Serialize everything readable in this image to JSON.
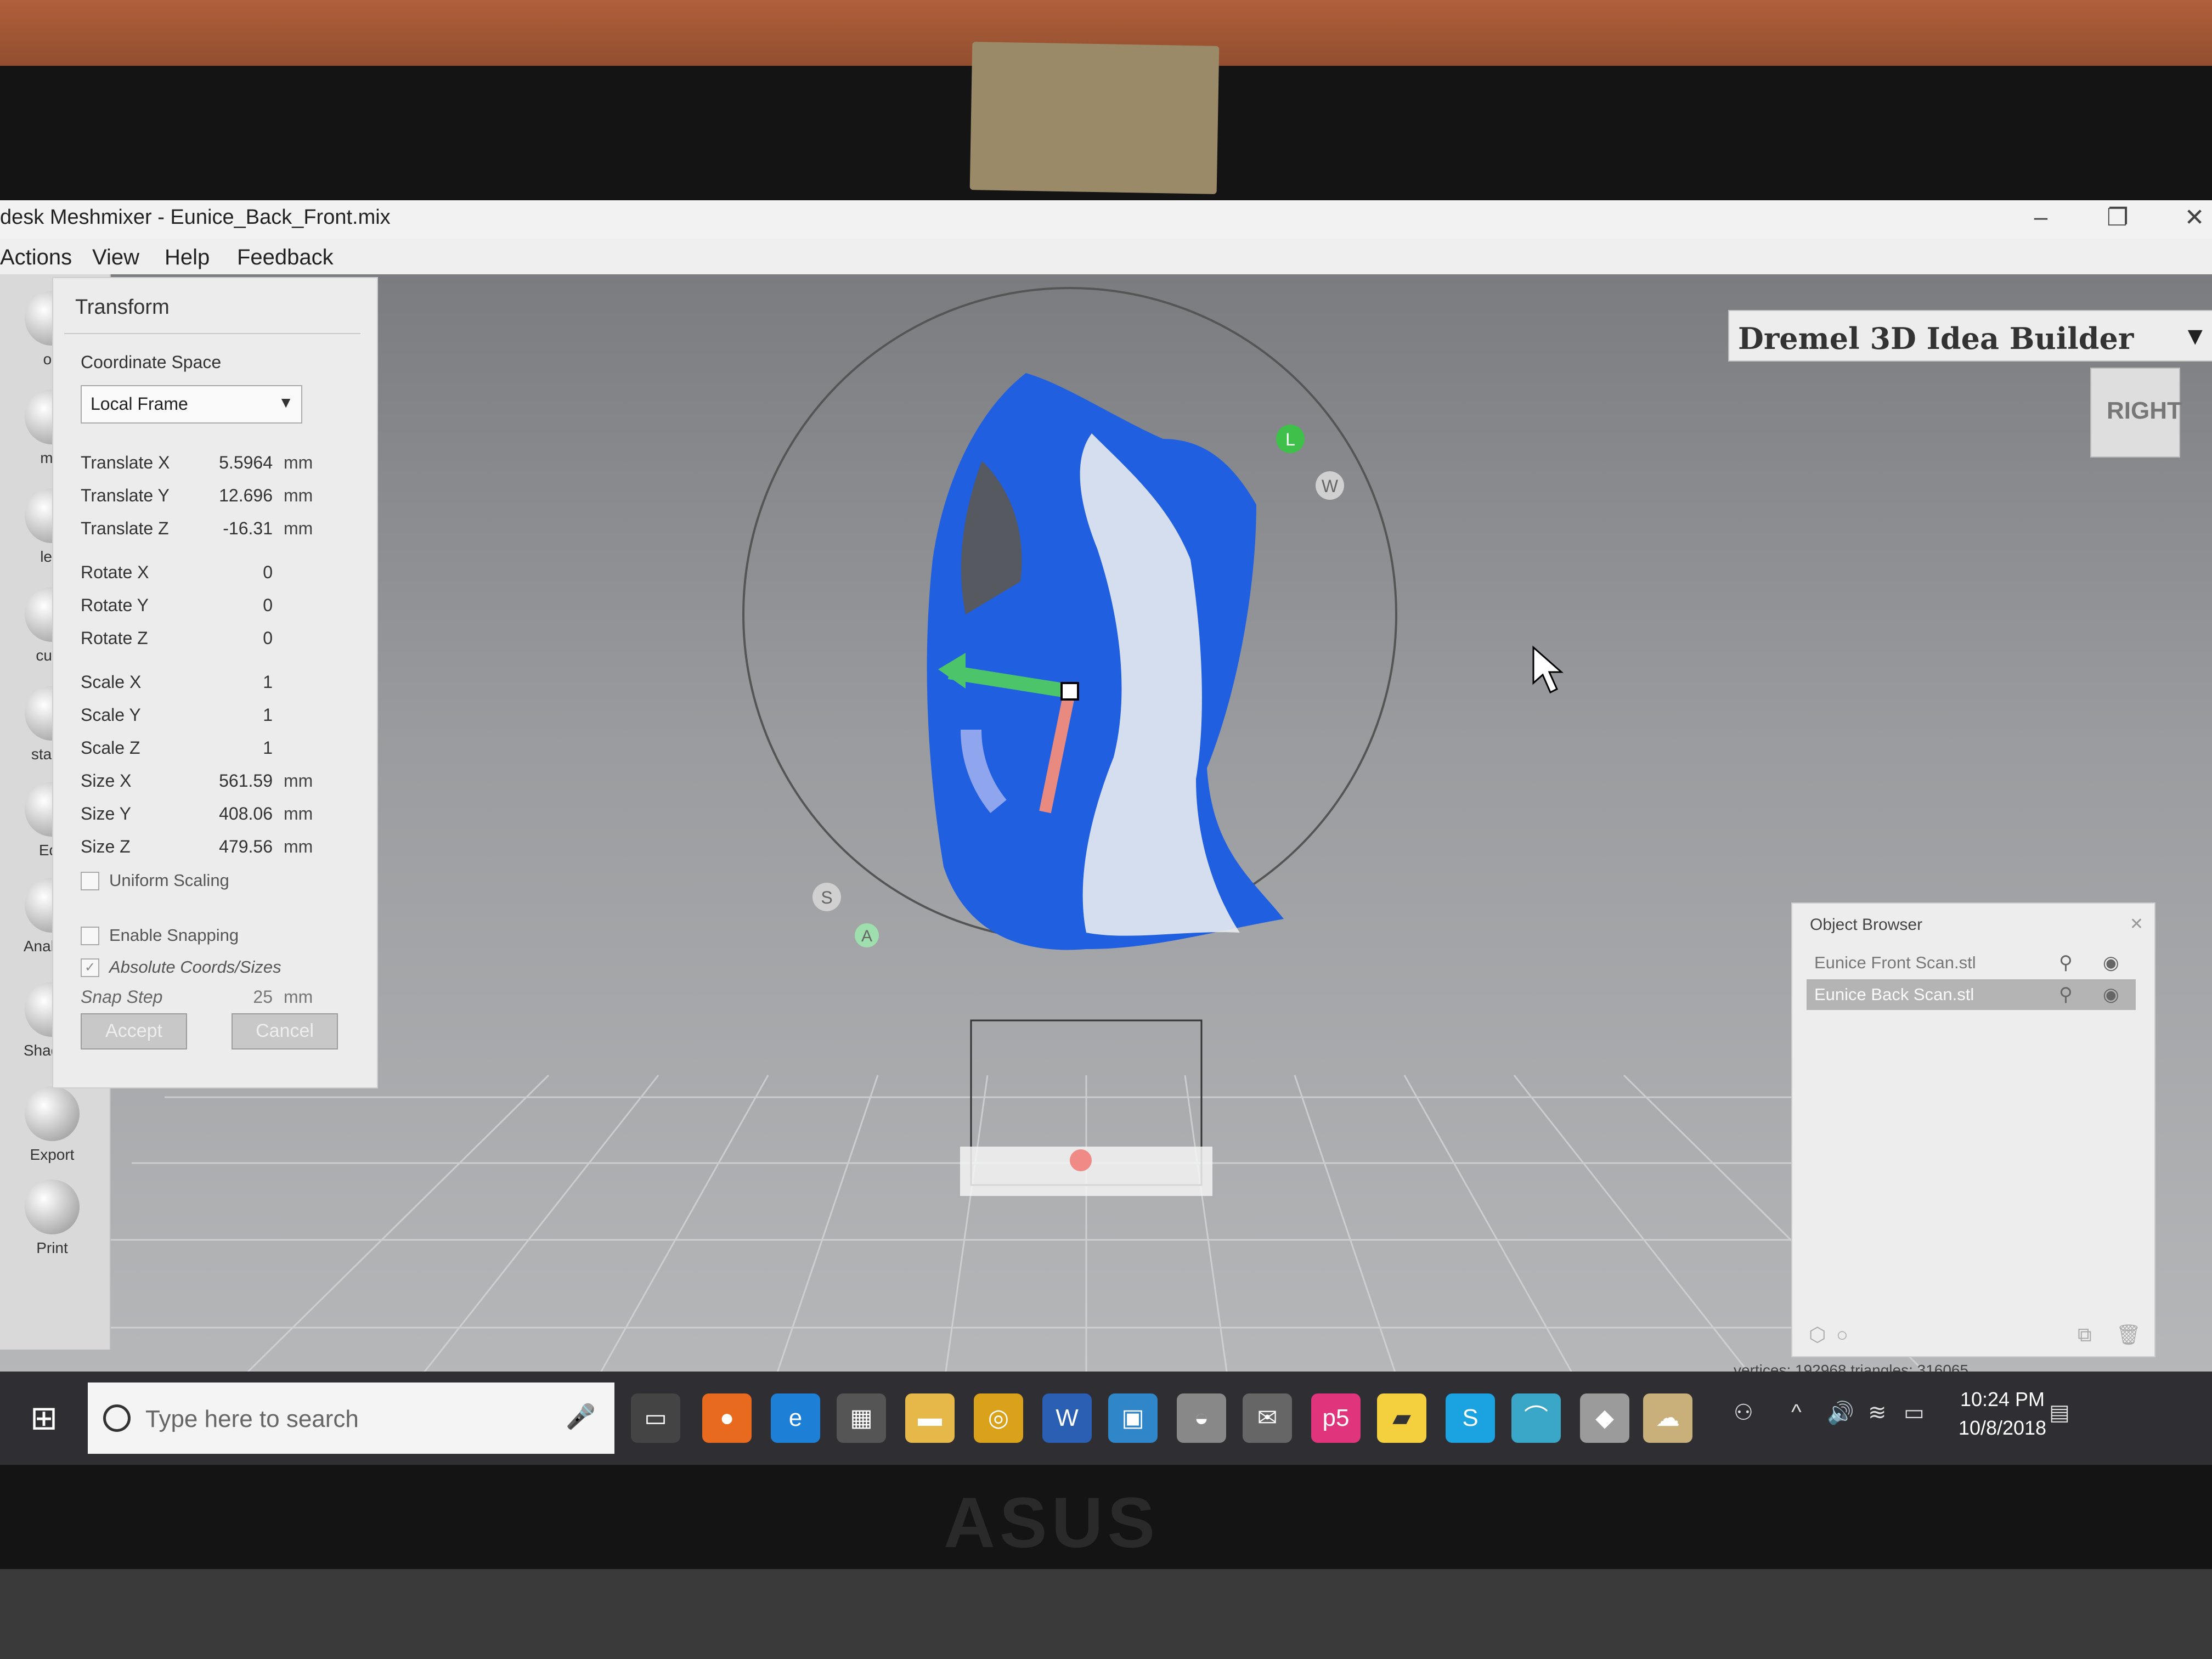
{
  "window": {
    "title": "desk Meshmixer - Eunice_Back_Front.mix",
    "minimize": "–",
    "restore": "❐",
    "close": "✕"
  },
  "menu": [
    "Actions",
    "View",
    "Help",
    "Feedback"
  ],
  "toolbar": {
    "items": [
      {
        "label": "ort",
        "icon": "import-icon"
      },
      {
        "label": "mix",
        "icon": "meshmix-icon"
      },
      {
        "label": "lect",
        "icon": "select-icon"
      },
      {
        "label": "culpt",
        "icon": "sculpt-icon"
      },
      {
        "label": "stamp",
        "icon": "stamp-icon"
      },
      {
        "label": "Edit",
        "icon": "edit-icon"
      },
      {
        "label": "Analysis",
        "icon": "analysis-icon"
      },
      {
        "label": "Shaders",
        "icon": "shaders-icon"
      },
      {
        "label": "Export",
        "icon": "export-icon"
      },
      {
        "label": "Print",
        "icon": "print-icon"
      }
    ]
  },
  "transform": {
    "title": "Transform",
    "coordinate_space_label": "Coordinate Space",
    "coordinate_space_value": "Local Frame",
    "translate": [
      {
        "name": "Translate X",
        "value": "5.5964",
        "unit": "mm"
      },
      {
        "name": "Translate Y",
        "value": "12.696",
        "unit": "mm"
      },
      {
        "name": "Translate Z",
        "value": "-16.31",
        "unit": "mm"
      }
    ],
    "rotate": [
      {
        "name": "Rotate X",
        "value": "0"
      },
      {
        "name": "Rotate Y",
        "value": "0"
      },
      {
        "name": "Rotate Z",
        "value": "0"
      }
    ],
    "scale": [
      {
        "name": "Scale X",
        "value": "1"
      },
      {
        "name": "Scale Y",
        "value": "1"
      },
      {
        "name": "Scale Z",
        "value": "1"
      }
    ],
    "size": [
      {
        "name": "Size X",
        "value": "561.59",
        "unit": "mm"
      },
      {
        "name": "Size Y",
        "value": "408.06",
        "unit": "mm"
      },
      {
        "name": "Size Z",
        "value": "479.56",
        "unit": "mm"
      }
    ],
    "uniform_scaling": "Uniform Scaling",
    "enable_snapping": "Enable Snapping",
    "absolute_coords": "Absolute Coords/Sizes",
    "snap_step_label": "Snap Step",
    "snap_step_value": "25",
    "snap_step_unit": "mm",
    "accept": "Accept",
    "cancel": "Cancel"
  },
  "printer": {
    "name": "Dremel 3D Idea Builder",
    "arrow": "▼"
  },
  "view_cube": {
    "label": "RIGHT"
  },
  "gizmo_labels": [
    "L",
    "W",
    "S",
    "A"
  ],
  "object_browser": {
    "title": "Object Browser",
    "close": "✕",
    "items": [
      {
        "name": "Eunice Front Scan.stl",
        "selected": false
      },
      {
        "name": "Eunice Back Scan.stl",
        "selected": true
      }
    ]
  },
  "status": {
    "text": "vertices: 192968 triangles: 316065"
  },
  "taskbar": {
    "search_placeholder": "Type here to search",
    "time": "10:24 PM",
    "date": "10/8/2018"
  },
  "colors": {
    "mesh_blue": "#1f5fe0",
    "mesh_white": "#e9ecef",
    "gizmo_green": "#4cc46a",
    "gizmo_red": "#e98a80",
    "gizmo_blue": "#8fa6ee"
  }
}
